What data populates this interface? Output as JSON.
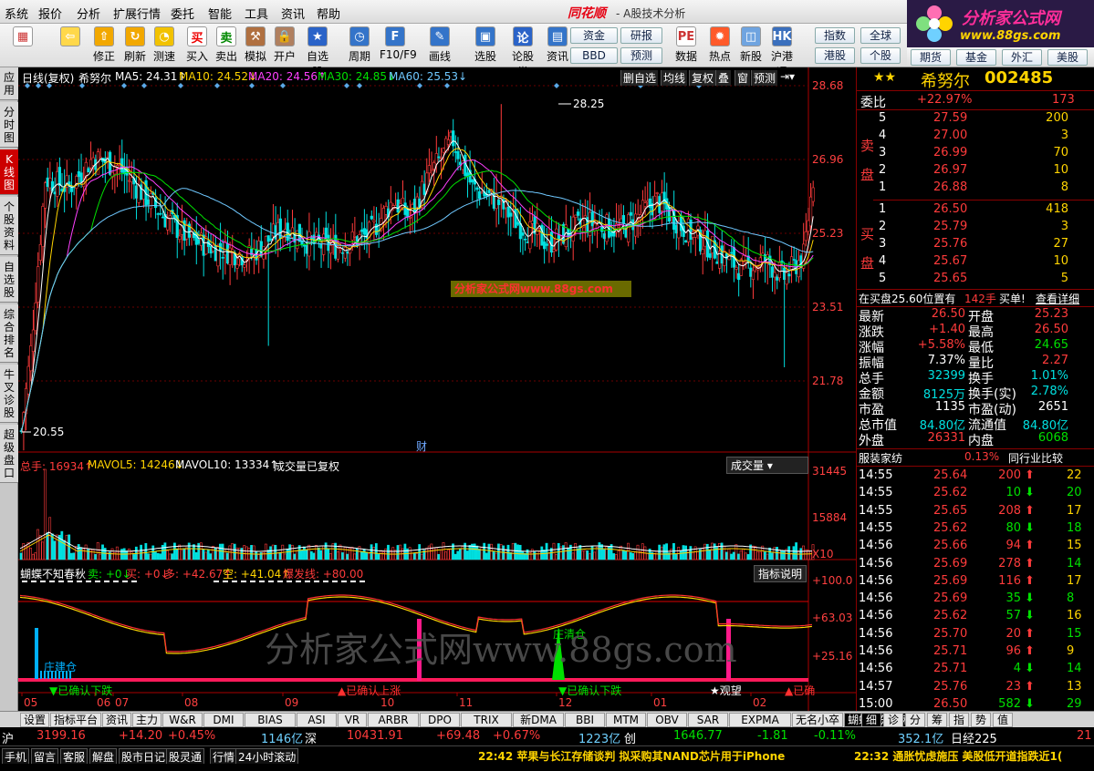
{
  "menu": [
    "系统",
    "报价",
    "分析",
    "扩展行情",
    "委托",
    "智能",
    "工具",
    "资讯",
    "帮助"
  ],
  "title": {
    "logo": "同花顺",
    "app": "- A股技术分析"
  },
  "brand": {
    "line1": "分析家公式网",
    "line2": "www.88gs.com"
  },
  "toolbar": {
    "buttons": [
      {
        "label": "",
        "icon": "windows-icon"
      },
      {
        "label": "",
        "icon": "back-arrow-icon"
      },
      {
        "label": "修正",
        "icon": "up-arrow-icon"
      },
      {
        "label": "刷新",
        "icon": "refresh-icon"
      },
      {
        "label": "测速",
        "icon": "clock-icon"
      },
      {
        "label": "买入",
        "icon": "buy-icon"
      },
      {
        "label": "卖出",
        "icon": "sell-icon"
      },
      {
        "label": "模拟",
        "icon": "hammer-icon"
      },
      {
        "label": "开户",
        "icon": "lock-icon"
      },
      {
        "label": "自选股",
        "icon": "star-icon"
      },
      {
        "label": "周期",
        "icon": "cycle-icon"
      },
      {
        "label": "F10/F9",
        "icon": "f10-icon"
      },
      {
        "label": "画线",
        "icon": "pen-icon"
      },
      {
        "label": "选股",
        "icon": "screen-icon"
      },
      {
        "label": "论股堂",
        "icon": "forum-icon"
      },
      {
        "label": "资讯",
        "icon": "news-icon"
      },
      {
        "label": "数据",
        "icon": "pe-icon"
      },
      {
        "label": "热点",
        "icon": "hot-icon"
      },
      {
        "label": "新股",
        "icon": "ipo-icon"
      },
      {
        "label": "沪港通",
        "icon": "sse-hkex-icon"
      }
    ],
    "boxes": [
      "资金",
      "研报",
      "BBD",
      "预测"
    ],
    "right_boxes": [
      "指数",
      "全球",
      "港股",
      "个股",
      "板块",
      "基金",
      "外汇",
      "美股"
    ],
    "right_row2": [
      "期货",
      "基金",
      "外汇",
      "美股"
    ]
  },
  "vtabs": [
    "应用",
    "分时图",
    "K线图",
    "个股资料",
    "自选股",
    "综合排名",
    "牛叉诊股",
    "超级盘口"
  ],
  "chart": {
    "header": {
      "period": "日线(复权)",
      "name": "希努尔",
      "ma5": "MA5: 24.31↑",
      "ma10": "MA10: 24.52↓",
      "ma20": "MA20: 24.56↑",
      "ma30": "MA30: 24.85↓",
      "ma60": "MA60: 25.53↓",
      "buttons": [
        "删自选",
        "均线",
        "复权",
        "叠",
        "窗",
        "预测"
      ]
    },
    "price_axis": [
      "28.68",
      "26.96",
      "25.23",
      "23.51",
      "21.78"
    ],
    "high_label": "28.25",
    "low_label": "20.55",
    "watermark_small": "分析家公式网www.88gs.com",
    "cai_label": "财",
    "volume": {
      "header": "总手: 16934↑",
      "mavol5": "MAVOL5: 14246↓",
      "mavol10": "MAVOL10: 13334↑",
      "note": "成交量已复权",
      "select": "成交量",
      "axis": [
        "31445",
        "15884",
        "X10"
      ]
    },
    "indicator": {
      "name": "蝴蝶不知春秋",
      "sell": "卖: +0↓",
      "buy": "买: +0↓",
      "long": "多: +42.67↑",
      "short": "空: +41.04↑",
      "burst": "爆发线: +80.00",
      "button": "指标说明",
      "axis": [
        "+100.0",
        "+63.03",
        "+25.16"
      ],
      "labels": [
        "庄建仓",
        "庄清仓",
        "▼已确认下跌",
        "▲已确认上涨",
        "▼已确认下跌",
        "★观望",
        "▲已确"
      ],
      "watermark": "分析家公式网www.88gs.com"
    },
    "x_axis": [
      "05",
      "06",
      "07",
      "08",
      "09",
      "10",
      "11",
      "12",
      "01",
      "02"
    ]
  },
  "quote": {
    "name": "希努尔",
    "code": "002485",
    "weibi_label": "委比",
    "weibi": "+22.97%",
    "weicha": "173",
    "sell_label": [
      "卖",
      "盘"
    ],
    "buy_label": [
      "买",
      "盘"
    ],
    "asks": [
      {
        "lvl": "5",
        "price": "27.59",
        "vol": "200"
      },
      {
        "lvl": "4",
        "price": "27.00",
        "vol": "3"
      },
      {
        "lvl": "3",
        "price": "26.99",
        "vol": "70"
      },
      {
        "lvl": "2",
        "price": "26.97",
        "vol": "10"
      },
      {
        "lvl": "1",
        "price": "26.88",
        "vol": "8"
      }
    ],
    "bids": [
      {
        "lvl": "1",
        "price": "26.50",
        "vol": "418"
      },
      {
        "lvl": "2",
        "price": "25.79",
        "vol": "3"
      },
      {
        "lvl": "3",
        "price": "25.76",
        "vol": "27"
      },
      {
        "lvl": "4",
        "price": "25.67",
        "vol": "10"
      },
      {
        "lvl": "5",
        "price": "25.65",
        "vol": "5"
      }
    ],
    "notice": {
      "text": "在买盘25.60位置有",
      "vol": "142手",
      "action": "买单!",
      "detail": "查看详细"
    },
    "stats": [
      {
        "l1": "最新",
        "v1": "26.50",
        "c1": "red",
        "l2": "开盘",
        "v2": "25.23",
        "c2": "red"
      },
      {
        "l1": "涨跌",
        "v1": "+1.40",
        "c1": "red",
        "l2": "最高",
        "v2": "26.50",
        "c2": "red"
      },
      {
        "l1": "涨幅",
        "v1": "+5.58%",
        "c1": "red",
        "l2": "最低",
        "v2": "24.65",
        "c2": "green"
      },
      {
        "l1": "振幅",
        "v1": "7.37%",
        "c1": "white",
        "l2": "量比",
        "v2": "2.27",
        "c2": "red"
      },
      {
        "l1": "总手",
        "v1": "32399",
        "c1": "cyan",
        "l2": "换手",
        "v2": "1.01%",
        "c2": "cyan"
      },
      {
        "l1": "金额",
        "v1": "8125万",
        "c1": "cyan",
        "l2": "换手(实)",
        "v2": "2.78%",
        "c2": "cyan"
      },
      {
        "l1": "市盈",
        "v1": "1135",
        "c1": "white",
        "l2": "市盈(动)",
        "v2": "2651",
        "c2": "white"
      },
      {
        "l1": "总市值",
        "v1": "84.80亿",
        "c1": "cyan",
        "l2": "流通值",
        "v2": "84.80亿",
        "c2": "cyan"
      },
      {
        "l1": "外盘",
        "v1": "26331",
        "c1": "red",
        "l2": "内盘",
        "v2": "6068",
        "c2": "green"
      }
    ],
    "industry": {
      "name": "服装家纺",
      "pct": "0.13%",
      "compare": "同行业比较"
    },
    "ticks": [
      {
        "t": "14:55",
        "p": "25.64",
        "v": "200",
        "d": "up"
      },
      {
        "t": "14:55",
        "p": "25.62",
        "v": "10",
        "d": "down"
      },
      {
        "t": "14:55",
        "p": "25.65",
        "v": "208",
        "d": "up"
      },
      {
        "t": "14:55",
        "p": "25.62",
        "v": "80",
        "d": "down"
      },
      {
        "t": "14:56",
        "p": "25.66",
        "v": "94",
        "d": "up"
      },
      {
        "t": "14:56",
        "p": "25.69",
        "v": "278",
        "d": "up"
      },
      {
        "t": "14:56",
        "p": "25.69",
        "v": "116",
        "d": "up"
      },
      {
        "t": "14:56",
        "p": "25.69",
        "v": "35",
        "d": "down"
      },
      {
        "t": "14:56",
        "p": "25.62",
        "v": "57",
        "d": "down"
      },
      {
        "t": "14:56",
        "p": "25.70",
        "v": "20",
        "d": "up"
      },
      {
        "t": "14:56",
        "p": "25.71",
        "v": "96",
        "d": "up"
      },
      {
        "t": "14:56",
        "p": "25.71",
        "v": "4",
        "d": "down"
      },
      {
        "t": "14:57",
        "p": "25.76",
        "v": "23",
        "d": "up"
      },
      {
        "t": "15:00",
        "p": "26.50",
        "v": "582",
        "d": "down"
      }
    ],
    "side_strip": [
      "22",
      "20",
      "17",
      "18",
      "15",
      "14",
      "17",
      "8",
      "16",
      "15",
      "9",
      "14",
      "13",
      "29"
    ],
    "tabs": [
      "细",
      "诊",
      "分",
      "筹",
      "指",
      "势",
      "值"
    ]
  },
  "bottom_tabs": [
    "设置",
    "指标平台",
    "资讯",
    "主力",
    "W&R",
    "DMI",
    "BIAS",
    "ASI",
    "VR",
    "ARBR",
    "DPO",
    "TRIX",
    "新DMA",
    "BBI",
    "MTM",
    "OBV",
    "SAR",
    "EXPMA",
    "无名小卒",
    "蝴蝶不知春秋"
  ],
  "status1": [
    {
      "label": "沪",
      "value": "3199.16",
      "chg": "+14.20",
      "pct": "+0.45%",
      "amt": "1146亿"
    },
    {
      "label": "深",
      "value": "10431.91",
      "chg": "+69.48",
      "pct": "+0.67%",
      "amt": "1223亿"
    },
    {
      "label": "创",
      "value": "1646.77",
      "chg": "-1.81",
      "pct": "-0.11%",
      "amt": "352.1亿"
    },
    {
      "label": "日经225",
      "value": "21"
    }
  ],
  "status2": {
    "items": [
      "手机",
      "留言",
      "客服",
      "解盘",
      "股市日记",
      "股灵通",
      "行情",
      "24小时滚动"
    ],
    "news1": "22:42 苹果与长江存储谈判 拟采购其NAND芯片用于iPhone",
    "news2": "22:32 通胀忧虑施压 美股低开道指跌近1("
  },
  "colors": {
    "up": "#ff3b3b",
    "down": "#00e0e0",
    "ma5": "#ffffff",
    "ma10": "#ffd400",
    "ma20": "#ff40ff",
    "ma30": "#00e000",
    "ma60": "#6fc8ff",
    "grid": "#6a0000"
  }
}
